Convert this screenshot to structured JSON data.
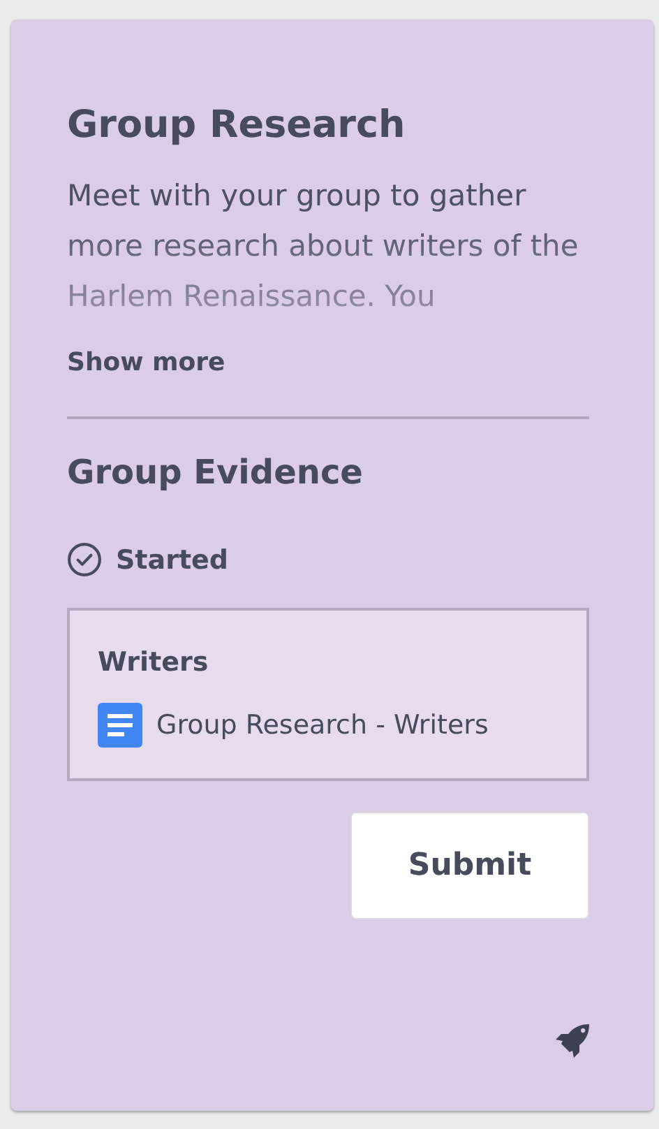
{
  "card": {
    "title": "Group Research",
    "description": "Meet with your group to gather more research about writers of the Harlem Renaissance. You",
    "show_more": "Show more",
    "section_title": "Group Evidence",
    "status": "Started",
    "evidence": {
      "title": "Writers",
      "attachment": "Group Research - Writers"
    },
    "submit_button": "Submit"
  }
}
